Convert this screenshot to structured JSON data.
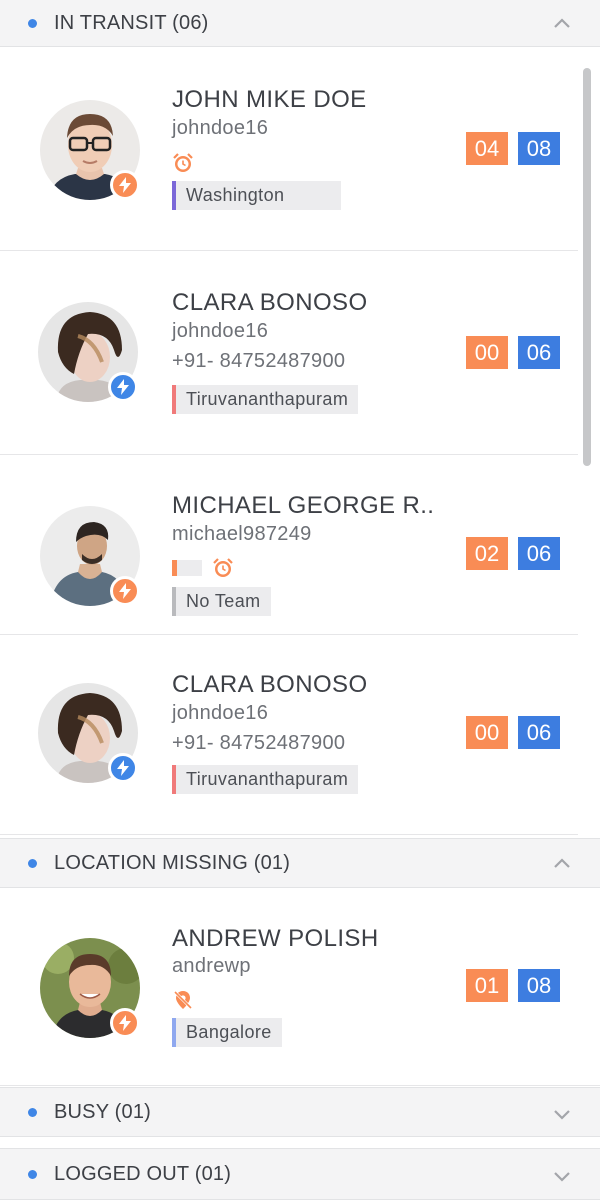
{
  "sections": [
    {
      "title": "IN TRANSIT (06)",
      "state": "expanded"
    },
    {
      "title": "LOCATION MISSING (01)",
      "state": "expanded"
    },
    {
      "title": "BUSY (01)",
      "state": "collapsed"
    },
    {
      "title": "LOGGED OUT (01)",
      "state": "collapsed"
    }
  ],
  "drivers": [
    {
      "name": "JOHN MIKE DOE",
      "username": "johndoe16",
      "phone": "",
      "alert_icon": "alarm-clock-icon",
      "team": "Washington",
      "team_color": "#7b68d8",
      "count_a": "04",
      "count_b": "08",
      "status": "orange"
    },
    {
      "name": "CLARA BONOSO",
      "username": "johndoe16",
      "phone": "+91- 84752487900",
      "alert_icon": "",
      "team": "Tiruvananthapuram",
      "team_color": "#f07a7a",
      "count_a": "00",
      "count_b": "06",
      "status": "blue"
    },
    {
      "name": "MICHAEL GEORGE R..",
      "username": "michael987249",
      "phone": "",
      "alert_icon": "alarm-clock-icon",
      "team": "No Team",
      "team_color": "#b9babd",
      "count_a": "02",
      "count_b": "06",
      "status": "orange"
    },
    {
      "name": "CLARA BONOSO",
      "username": "johndoe16",
      "phone": "+91- 84752487900",
      "alert_icon": "",
      "team": "Tiruvananthapuram",
      "team_color": "#f07a7a",
      "count_a": "00",
      "count_b": "06",
      "status": "blue"
    },
    {
      "name": "ANDREW POLISH",
      "username": "andrewp",
      "phone": "",
      "alert_icon": "location-off-icon",
      "team": "Bangalore",
      "team_color": "#8fa8ef",
      "count_a": "01",
      "count_b": "08",
      "status": "orange"
    }
  ],
  "colors": {
    "accent_orange": "#f98c55",
    "accent_blue": "#3d7de0",
    "header_bg": "#f4f4f5"
  }
}
